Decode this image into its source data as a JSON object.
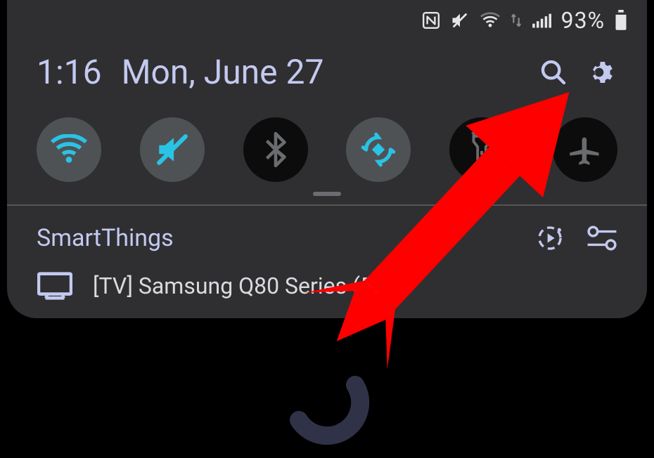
{
  "status": {
    "battery_percent": "93%"
  },
  "header": {
    "time": "1:16",
    "date": "Mon, June 27"
  },
  "toggles": {
    "wifi": {
      "on": true
    },
    "sound": {
      "on": true
    },
    "bluetooth": {
      "on": false
    },
    "rotate": {
      "on": true
    },
    "flashlight": {
      "on": false
    },
    "airplane": {
      "on": false
    }
  },
  "media": {
    "title": "SmartThings",
    "device_name": "[TV] Samsung Q80 Series (55)"
  },
  "colors": {
    "accent": "#c4c9f0",
    "toggle_icon_active": "#29c3e6",
    "toggle_icon_inactive": "#6a6c6f",
    "annotation": "#ff0000"
  }
}
